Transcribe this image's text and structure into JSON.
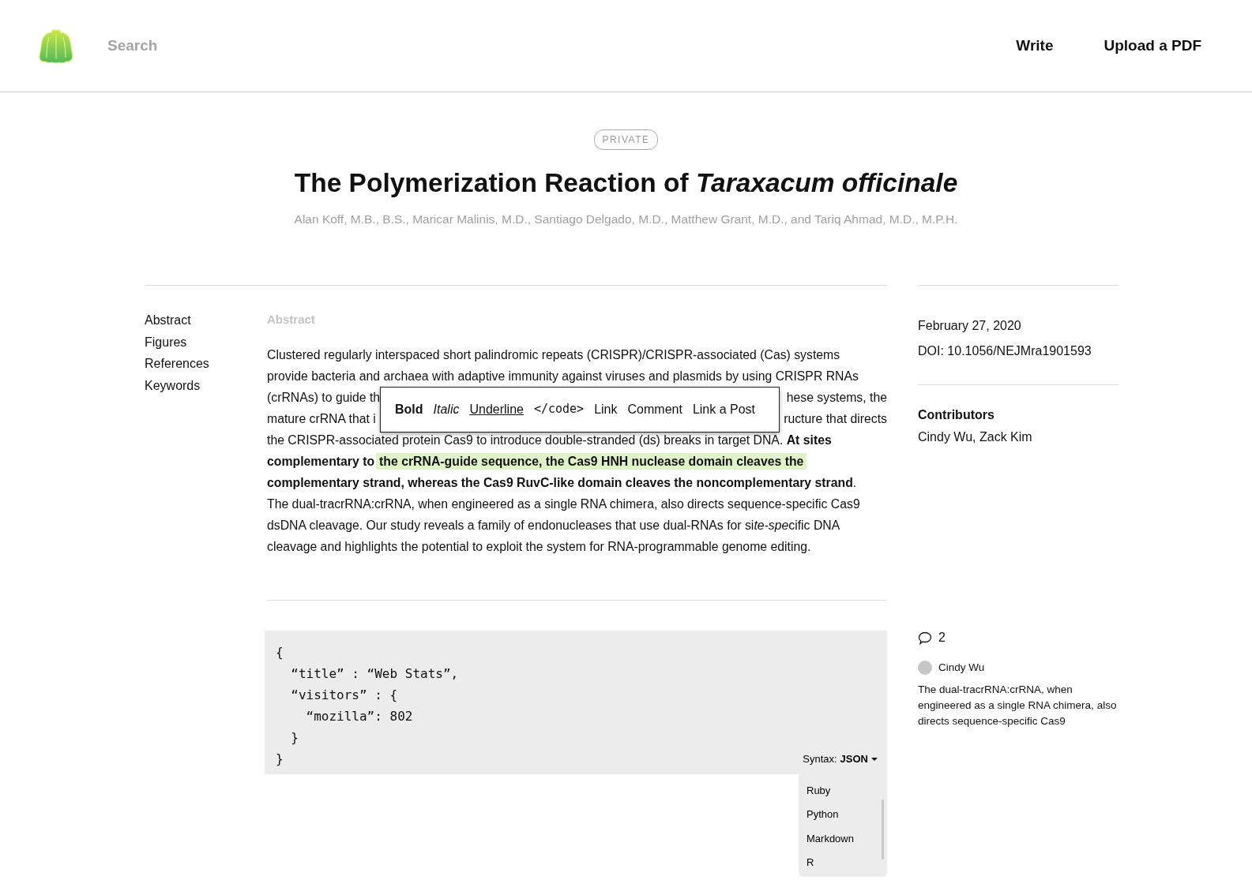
{
  "header": {
    "search": {
      "placeholder": "Search"
    },
    "nav": [
      "Write",
      "Upload a PDF"
    ]
  },
  "article": {
    "badge": "PRIVATE",
    "title": "The Polymerization Reaction of *Taraxacum officinale*",
    "authors": "Alan Koff, M.B., B.S., Maricar Malinis, M.D., Santiago Delgado, M.D., Matthew Grant, M.D., and Tariq Ahmad, M.D., M.P.H."
  },
  "toc": [
    "Abstract",
    "Figures",
    "References",
    "Keywords"
  ],
  "abstract": {
    "heading": "Abstract",
    "lines": [
      {
        "kind": "full",
        "segments": [
          {
            "kind": "plain",
            "text": "Clustered regularly interspaced short palindromic repeats (CRISPR)/CRISPR-associated (Cas) systems"
          }
        ]
      },
      {
        "kind": "full",
        "segments": [
          {
            "kind": "plain",
            "text": "provide bacteria and archaea with adaptive immunity against viruses and plasmids by using CRISPR RNAs"
          }
        ]
      },
      {
        "kind": "split",
        "segments": [
          {
            "kind": "plain",
            "text": "(crRNAs) to guide th"
          },
          {
            "kind": "plain",
            "text": "hese systems, the"
          }
        ]
      },
      {
        "kind": "split",
        "segments": [
          {
            "kind": "plain",
            "text": "mature crRNA that i"
          },
          {
            "kind": "plain",
            "text": "ructure that directs"
          }
        ]
      },
      {
        "kind": "full",
        "segments": [
          {
            "kind": "plain",
            "text": "the CRISPR-associated protein Cas9 to introduce double-stranded (ds) breaks in target DNA. **At sites**"
          }
        ]
      },
      {
        "kind": "full",
        "segments": [
          {
            "kind": "plain",
            "text": "**complementary to**"
          },
          {
            "kind": "highlight",
            "text": "the crRNA-guide sequence, the Cas9 HNH nuclease domain cleaves the"
          }
        ]
      },
      {
        "kind": "full",
        "segments": [
          {
            "kind": "plain",
            "text": "**complementary strand, whereas the Cas9 RuvC-like domain cleaves the noncomplementary strand**."
          }
        ]
      },
      {
        "kind": "full",
        "segments": [
          {
            "kind": "plain",
            "text": "The dual-tracrRNA:crRNA, when engineered as a single RNA chimera, also directs sequence-specific Cas9"
          }
        ]
      },
      {
        "kind": "full",
        "segments": [
          {
            "kind": "plain",
            "text": "dsDNA cleavage. Our study reveals a family of endonucleases that use dual-RNAs for si"
          },
          {
            "kind": "italic",
            "text": "te-spe"
          },
          {
            "kind": "plain",
            "text": "cific DNA"
          }
        ]
      },
      {
        "kind": "full",
        "segments": [
          {
            "kind": "plain",
            "text": "cleavage and highlights the potential to exploit the system for RNA-programmable genome editing."
          }
        ]
      }
    ]
  },
  "toolbar": [
    {
      "label": "Bold",
      "kind": "bold"
    },
    {
      "label": "Italic",
      "kind": "italic"
    },
    {
      "label": "Underline",
      "kind": "underline"
    },
    {
      "label": "</code>",
      "kind": "code"
    },
    {
      "label": "Link",
      "kind": "plain"
    },
    {
      "label": "Comment",
      "kind": "plain"
    },
    {
      "label": "Link a Post",
      "kind": "plain"
    }
  ],
  "code": {
    "lines": [
      "{",
      "  “title” : “Web Stats”,",
      "  “visitors” : {",
      "    “mozilla”: 802",
      "  }",
      "}"
    ],
    "syntax_label": "Syntax:",
    "syntax_value": "JSON",
    "options": [
      "Ruby",
      "Python",
      "Markdown",
      "R"
    ]
  },
  "sidebar": {
    "date": "February 27, 2020",
    "doi": "DOI: 10.1056/NEJMra1901593",
    "contributors_heading": "Contributors",
    "contributors": "Cindy Wu, Zack Kim",
    "comment_count": "2",
    "comments": [
      {
        "author": "Cindy Wu",
        "text": "The dual-tracrRNA:crRNA, when engineered as a single RNA chimera, also directs sequence-specific Cas9"
      }
    ]
  }
}
